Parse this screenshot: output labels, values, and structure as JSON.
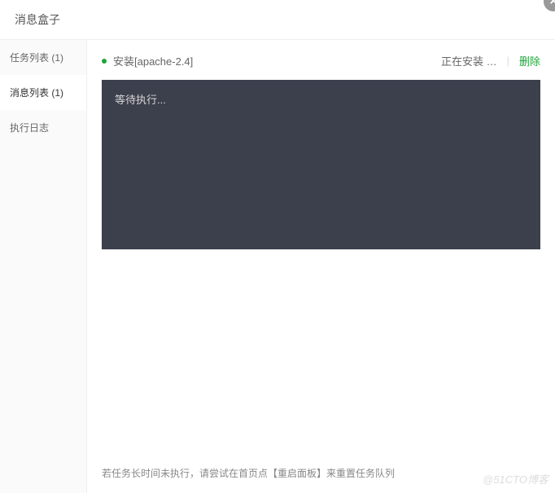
{
  "header": {
    "title": "消息盒子"
  },
  "close": {
    "symbol": "×"
  },
  "sidebar": {
    "items": [
      {
        "label": "任务列表 (1)",
        "active": false
      },
      {
        "label": "消息列表 (1)",
        "active": true
      },
      {
        "label": "执行日志",
        "active": false
      }
    ]
  },
  "task": {
    "name": "安装[apache-2.4]",
    "status": "正在安装 …",
    "divider": "|",
    "delete": "删除"
  },
  "console": {
    "text": "等待执行..."
  },
  "footer": {
    "hint": "若任务长时间未执行，请尝试在首页点【重启面板】来重置任务队列"
  },
  "watermark": "@51CTO博客"
}
